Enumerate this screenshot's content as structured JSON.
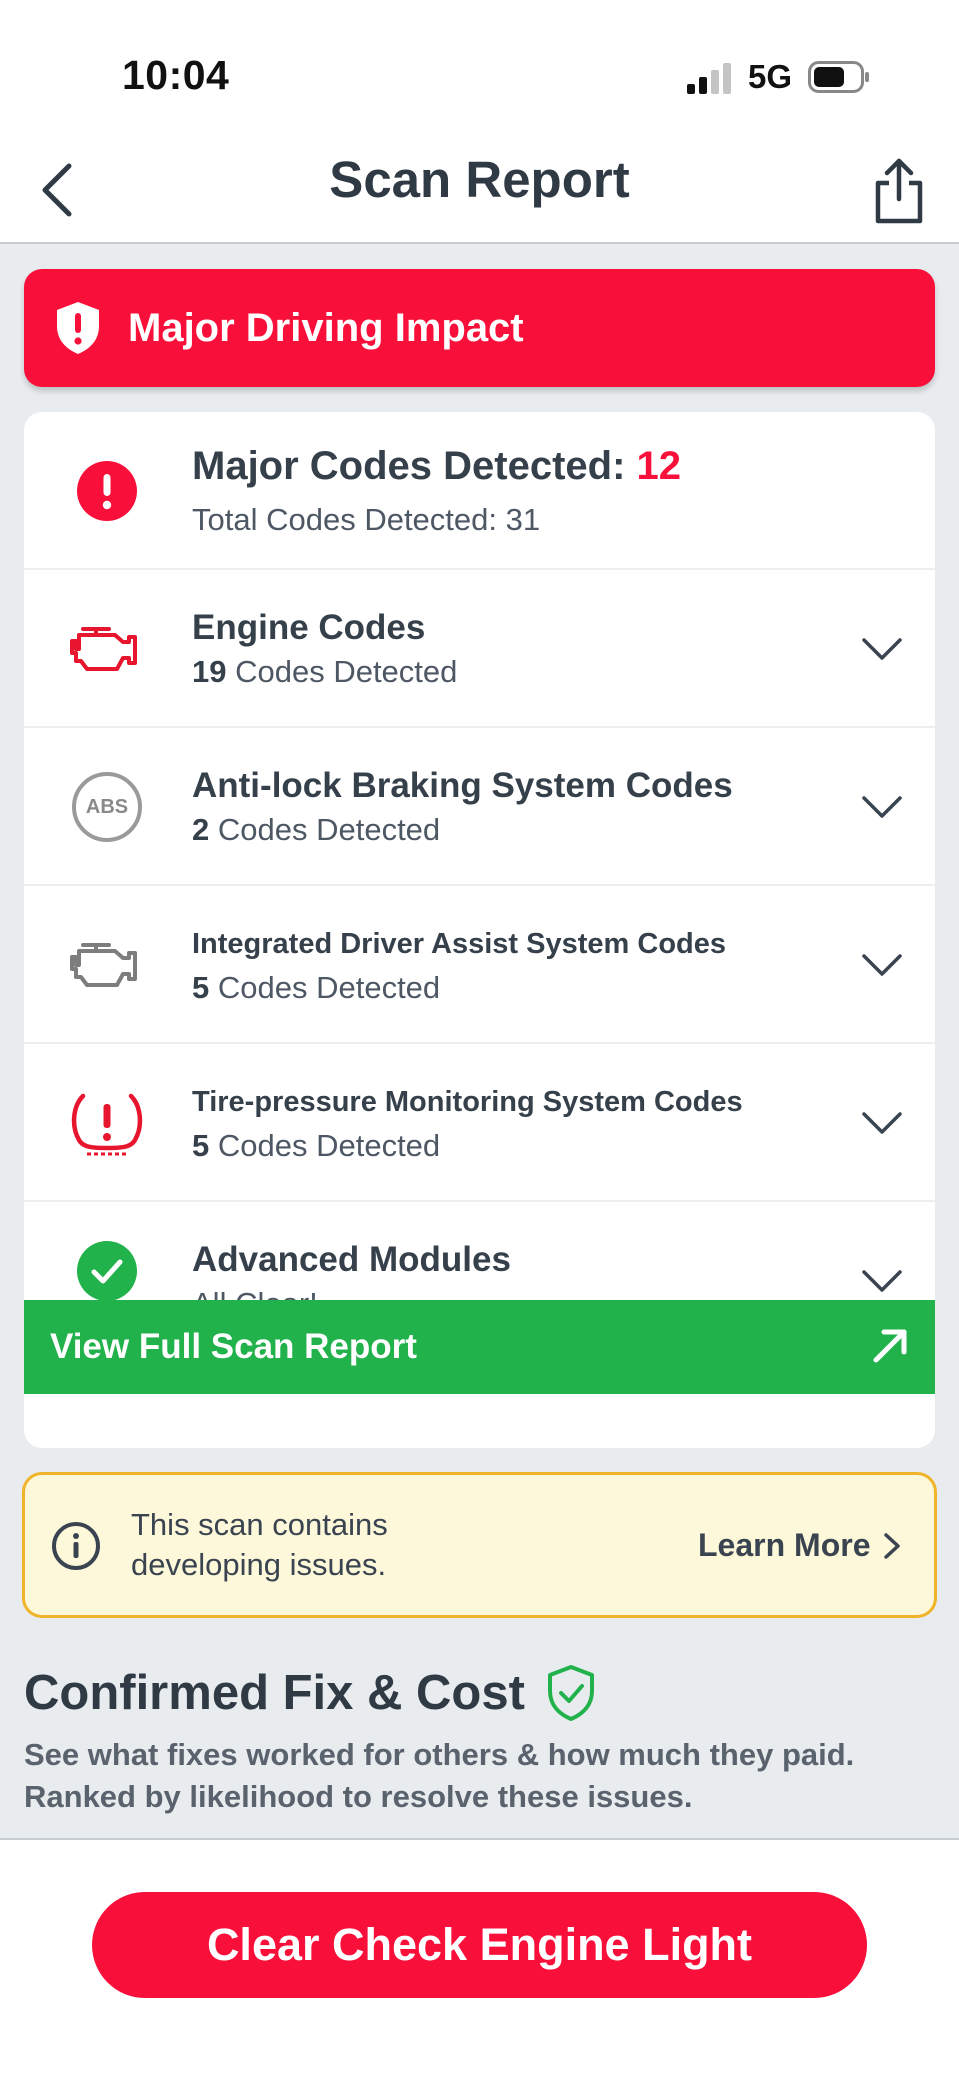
{
  "status_bar": {
    "time": "10:04",
    "network": "5G"
  },
  "nav": {
    "title": "Scan Report"
  },
  "banner": {
    "label": "Major Driving Impact"
  },
  "summary": {
    "major_label": "Major Codes Detected:",
    "major_count": "12",
    "total_label": "Total Codes Detected: 31"
  },
  "categories": [
    {
      "title": "Engine Codes",
      "count": "19",
      "count_suffix": " Codes Detected"
    },
    {
      "title": "Anti-lock Braking System Codes",
      "count": "2",
      "count_suffix": " Codes Detected"
    },
    {
      "title": "Integrated Driver Assist System Codes",
      "count": "5",
      "count_suffix": " Codes Detected"
    },
    {
      "title": "Tire-pressure Monitoring System Codes",
      "count": "5",
      "count_suffix": " Codes Detected"
    },
    {
      "title": "Advanced Modules",
      "status": "All Clear!"
    }
  ],
  "abs_icon_text": "ABS",
  "view_report": {
    "label": "View Full Scan Report"
  },
  "notice": {
    "text": "This scan contains developing issues.",
    "link": "Learn More"
  },
  "confirmed_fix": {
    "title": "Confirmed Fix & Cost",
    "description": "See what fixes worked for others & how much they paid. Ranked by likelihood to resolve these issues."
  },
  "cta": {
    "label": "Clear Check Engine Light"
  },
  "colors": {
    "red": "#f8103b",
    "green": "#22b24c",
    "notice_bg": "#fdf8d9",
    "notice_border": "#f0b42a"
  }
}
